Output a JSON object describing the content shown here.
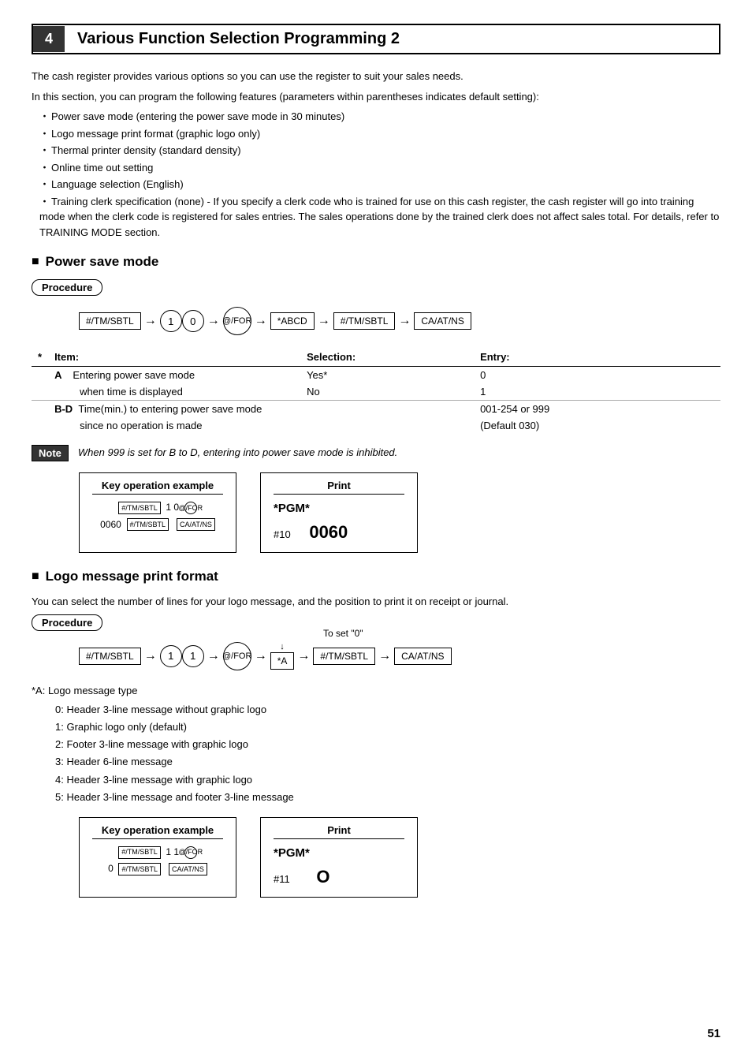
{
  "header": {
    "number": "4",
    "title": "Various Function Selection Programming 2"
  },
  "intro": {
    "line1": "The cash register provides various options so you can use the register to suit your sales needs.",
    "line2": "In this section, you can program the following features (parameters within parentheses indicates default setting):",
    "bullets": [
      "Power save mode (entering the power save mode in 30 minutes)",
      "Logo message print format (graphic logo only)",
      "Thermal printer density (standard density)",
      "Online time out setting",
      "Language selection (English)",
      "Training clerk specification (none) - If you specify a clerk code who is trained for use on this cash register, the cash register will go into training mode when the clerk code is registered for sales entries.  The sales operations done by the trained clerk does not affect sales total.  For details, refer to TRAINING MODE section."
    ]
  },
  "power_save": {
    "section_title": "Power save mode",
    "procedure_label": "Procedure",
    "flow": [
      "#/TM/SBTL",
      "→",
      "1",
      "0",
      "→",
      "@/FOR",
      "→",
      "*ABCD",
      "→",
      "#/TM/SBTL",
      "→",
      "CA/AT/NS"
    ],
    "table": {
      "col_item": "Item:",
      "col_selection": "Selection:",
      "col_entry": "Entry:",
      "star_label": "*",
      "rows": [
        {
          "item_code": "A",
          "item_desc1": "Entering power save mode",
          "item_desc2": "",
          "selection": "Yes*",
          "entry": "0"
        },
        {
          "item_code": "",
          "item_desc1": "when time is displayed",
          "item_desc2": "",
          "selection": "No",
          "entry": "1"
        },
        {
          "item_code": "B-D",
          "item_desc1": "Time(min.) to entering power save mode",
          "item_desc2": "since no operation is made",
          "selection": "",
          "entry1": "001-254 or 999",
          "entry2": "(Default 030)"
        }
      ]
    },
    "note_label": "Note",
    "note_text": "When 999 is set for B to D, entering into power save mode is inhibited.",
    "key_op_title": "Key operation example",
    "key_op_lines": [
      "#/TM/SBTL  10  @/FOR",
      "0060  #/TM/SBTL  CA/AT/NS"
    ],
    "print_title": "Print",
    "print_lines": [
      "*PGM*",
      "#10",
      "0060"
    ]
  },
  "logo_message": {
    "section_title": "Logo message print format",
    "intro": "You can select the number of lines for your logo message, and the position to print it on receipt or journal.",
    "procedure_label": "Procedure",
    "to_set_label": "To set \"0\"",
    "flow": [
      "#/TM/SBTL",
      "→",
      "1",
      "1",
      "→",
      "@/FOR",
      "→",
      "*A",
      "→",
      "#/TM/SBTL",
      "→",
      "CA/AT/NS"
    ],
    "star_a_label": "*A:  Logo message type",
    "logo_types": [
      "0:   Header 3-line message without graphic logo",
      "1:   Graphic logo only (default)",
      "2:   Footer 3-line message with graphic logo",
      "3:   Header 6-line message",
      "4:   Header 3-line message with graphic logo",
      "5:   Header 3-line message and footer 3-line message"
    ],
    "key_op_title": "Key operation example",
    "key_op_lines": [
      "#/TM/SBTL  11  @/FOR",
      "0  #/TM/SBTL  CA/AT/NS"
    ],
    "print_title": "Print",
    "print_lines": [
      "*PGM*",
      "#11",
      "O"
    ]
  },
  "page_number": "51"
}
